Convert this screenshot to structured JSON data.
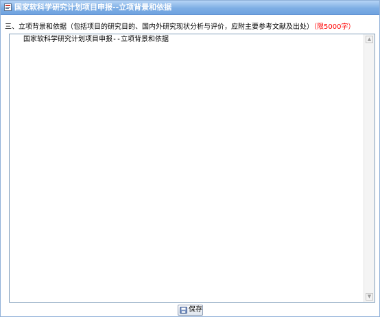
{
  "window": {
    "title": "国家软科学研究计划项目申报--立项背景和依据"
  },
  "section": {
    "heading": "三、立项背景和依据（包括项目的研究目的、国内外研究现状分析与评价，应附主要参考文献及出处）",
    "limit": "（限5000字）"
  },
  "editor": {
    "content": "国家软科学研究计划项目申报--立项背景和依据"
  },
  "actions": {
    "save_label": "保存"
  },
  "colors": {
    "titlebar": "#7eaee4",
    "limit_text": "#ff0000",
    "editor_border": "#7f9db9"
  },
  "icons": {
    "title": "document-icon",
    "save": "save-icon"
  }
}
